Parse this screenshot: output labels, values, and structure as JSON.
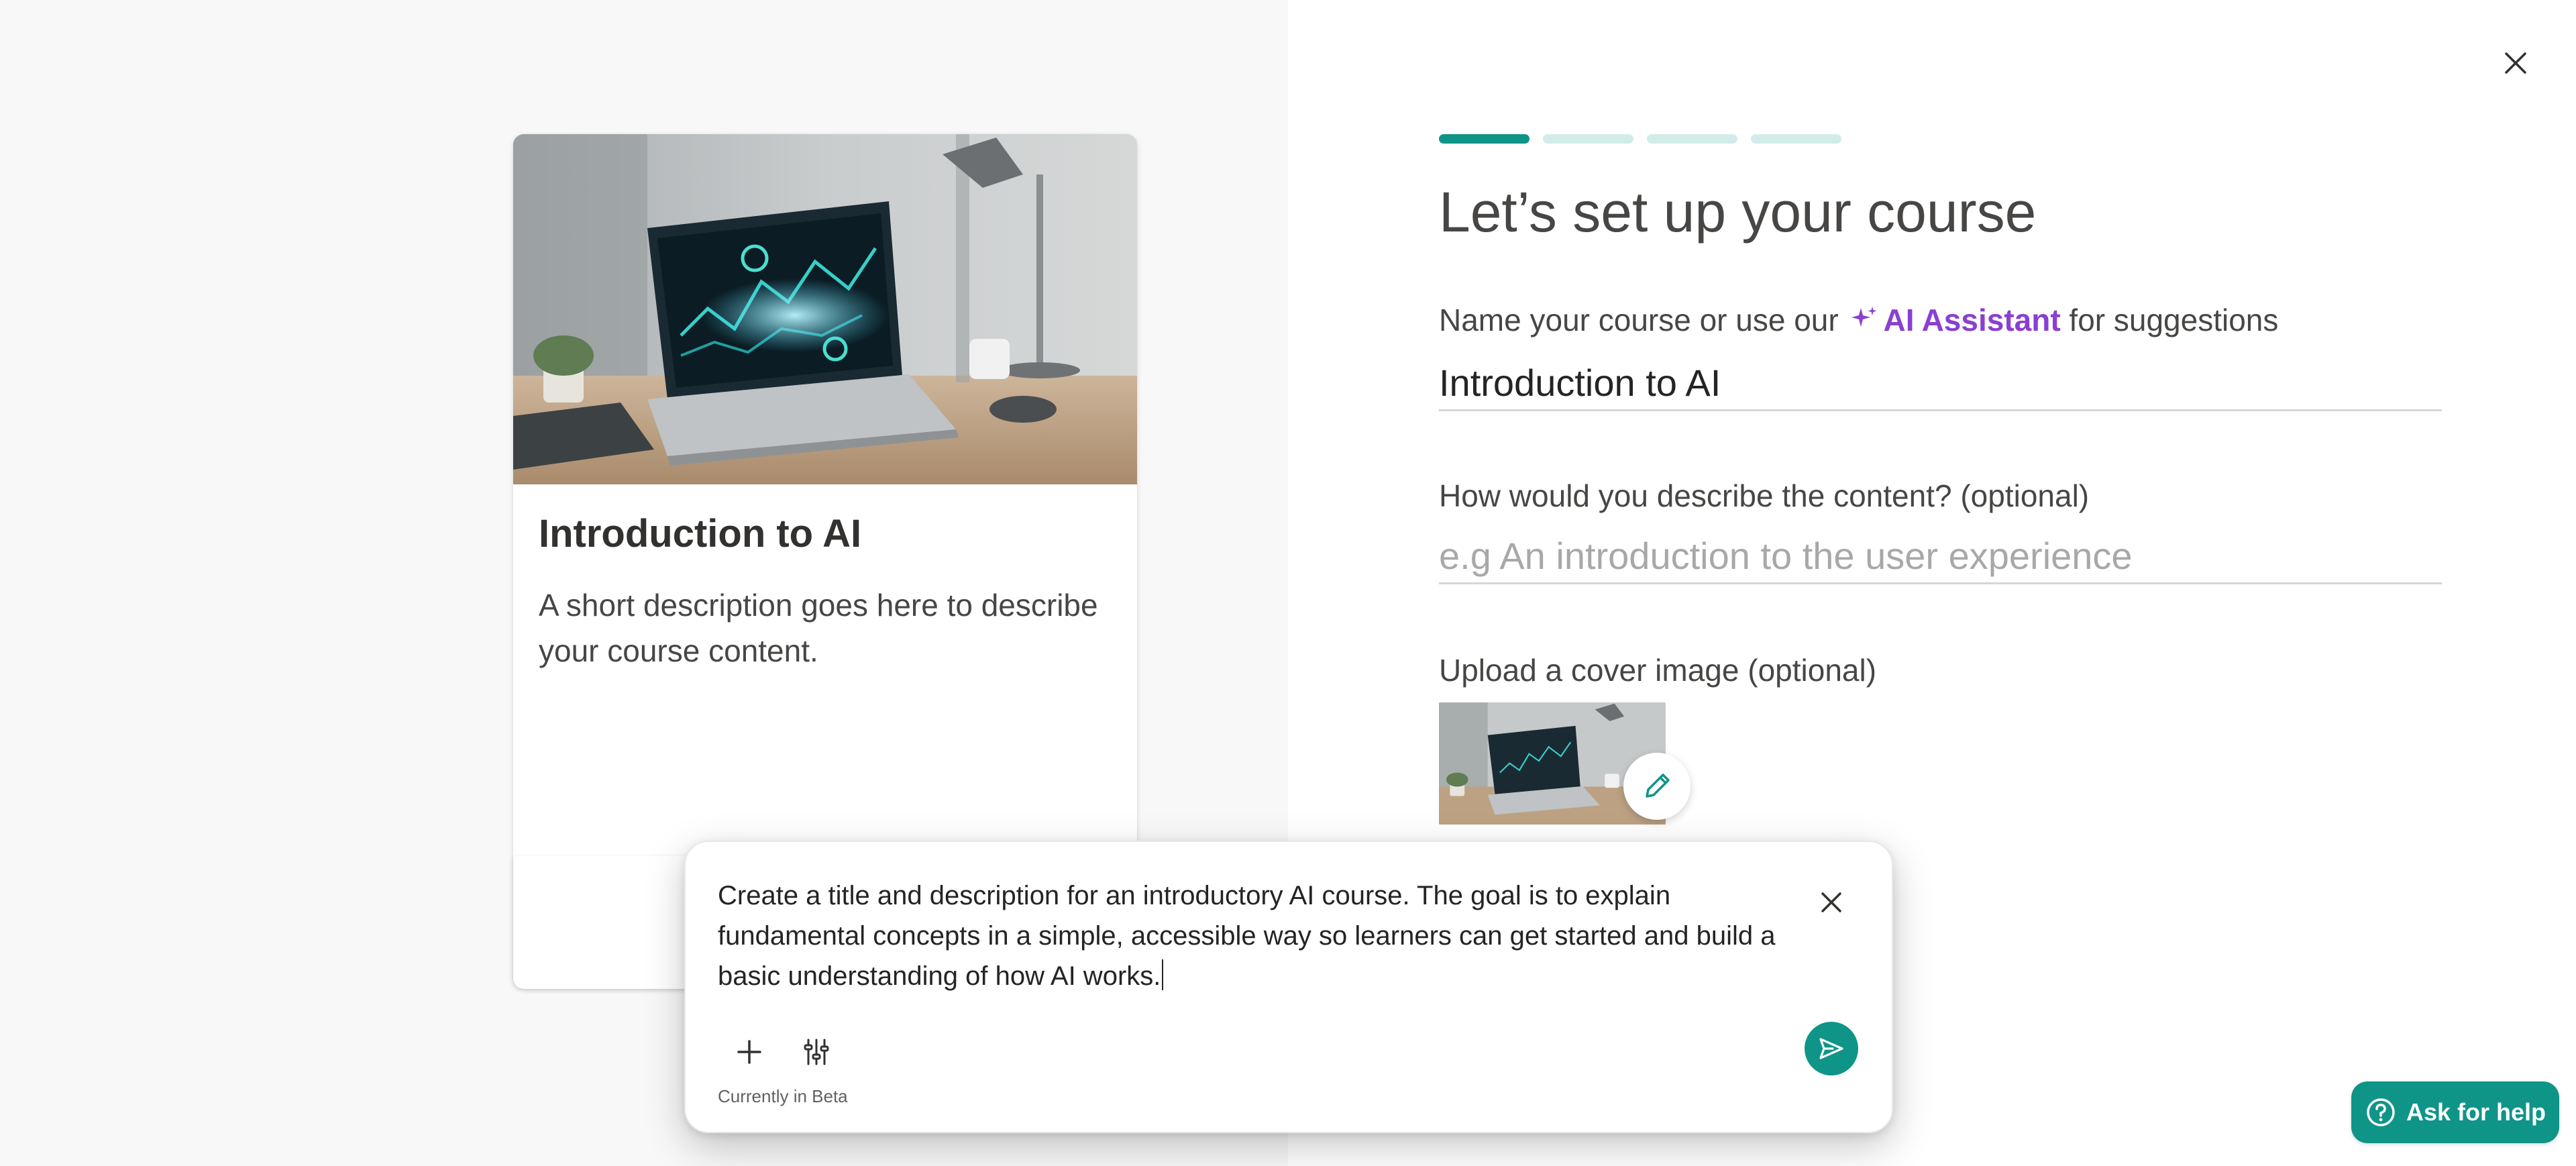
{
  "preview": {
    "title": "Introduction to AI",
    "description": "A short description goes here to describe your course content."
  },
  "form": {
    "heading": "Let’s set up your course",
    "progress": {
      "current_step": 1,
      "total_steps": 4
    },
    "name_label_prefix": "Name your course or use our",
    "ai_assistant_link": "AI Assistant",
    "name_label_suffix": "for suggestions",
    "name_value": "Introduction to AI",
    "description_label": "How would you describe the content? (optional)",
    "description_placeholder": "e.g An introduction to the user experience",
    "cover_label": "Upload a cover image (optional)"
  },
  "prompt": {
    "text": "Create a title and description for an introductory AI course. The goal is to explain fundamental concepts in a simple, accessible way so learners can get started and build a basic understanding of how AI works.",
    "beta_note": "Currently in Beta"
  },
  "help": {
    "label": "Ask for help"
  },
  "icons": {
    "close": "close-icon",
    "sparkle": "sparkle-icon",
    "edit": "pencil-icon",
    "add": "plus-icon",
    "settings": "sliders-icon",
    "send": "send-icon",
    "help": "question-circle-icon"
  },
  "colors": {
    "accent": "#0f9488",
    "ai_purple": "#8a3fd1",
    "progress_inactive": "#d2ecea"
  }
}
